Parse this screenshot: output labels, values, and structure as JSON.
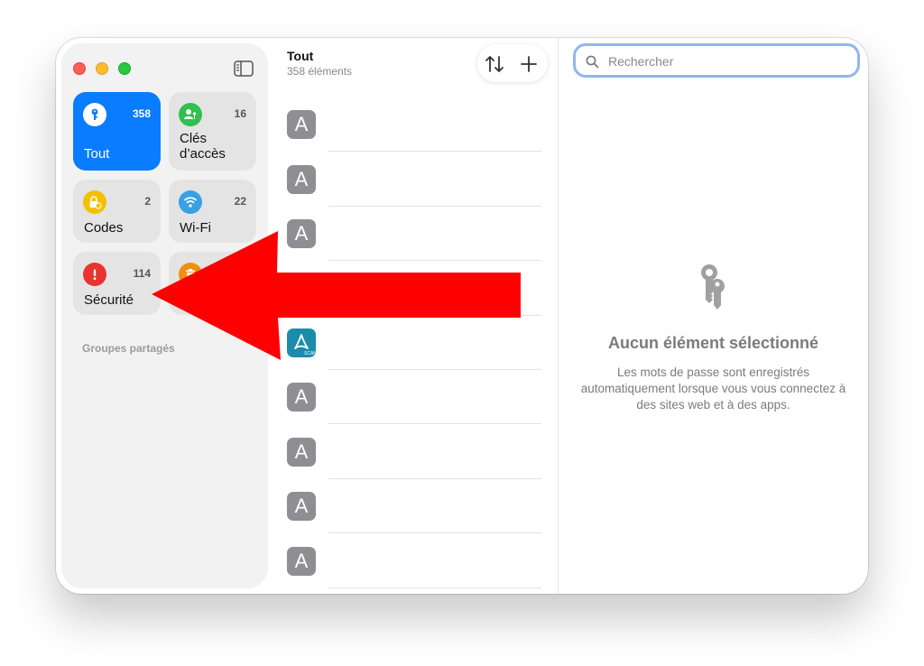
{
  "colors": {
    "accent": "#0a7cff",
    "arrow": "#ff0000",
    "all_icon": "#0a7cff",
    "passkeys_icon": "#30c04f",
    "codes_icon": "#f2c100",
    "wifi_icon": "#3aa0e4",
    "security_icon": "#e8332e",
    "deleted_icon": "#f0900e"
  },
  "sidebar": {
    "tiles": [
      {
        "label": "Tout",
        "count": "358",
        "icon": "key-icon"
      },
      {
        "label": "Clés d’accès",
        "count": "16",
        "icon": "passkey-person-icon"
      },
      {
        "label": "Codes",
        "count": "2",
        "icon": "lock-clock-icon"
      },
      {
        "label": "Wi-Fi",
        "count": "22",
        "icon": "wifi-icon"
      },
      {
        "label": "Sécurité",
        "count": "114",
        "icon": "exclamation-icon"
      },
      {
        "label": "",
        "count": "",
        "icon": "trash-icon"
      }
    ],
    "shared_groups_header": "Groupes partagés"
  },
  "list": {
    "title": "Tout",
    "subtitle": "358 éléments",
    "sort_icon": "sort-arrows-icon",
    "add_icon": "plus-icon",
    "items": [
      {
        "letter": "A",
        "icon": "letter-avatar"
      },
      {
        "letter": "A",
        "icon": "letter-avatar"
      },
      {
        "letter": "A",
        "icon": "letter-avatar"
      },
      {
        "letter": "",
        "icon": "hidden-by-arrow"
      },
      {
        "letter": "",
        "icon": "adobe-scan-icon"
      },
      {
        "letter": "A",
        "icon": "letter-avatar"
      },
      {
        "letter": "A",
        "icon": "letter-avatar"
      },
      {
        "letter": "A",
        "icon": "letter-avatar"
      },
      {
        "letter": "A",
        "icon": "letter-avatar"
      }
    ]
  },
  "search": {
    "placeholder": "Rechercher"
  },
  "detail": {
    "title": "Aucun élément sélectionné",
    "text": "Les mots de passe sont enregistrés automatiquement lorsque vous vous connectez à des sites web et à des apps.",
    "icon": "keys-icon"
  }
}
